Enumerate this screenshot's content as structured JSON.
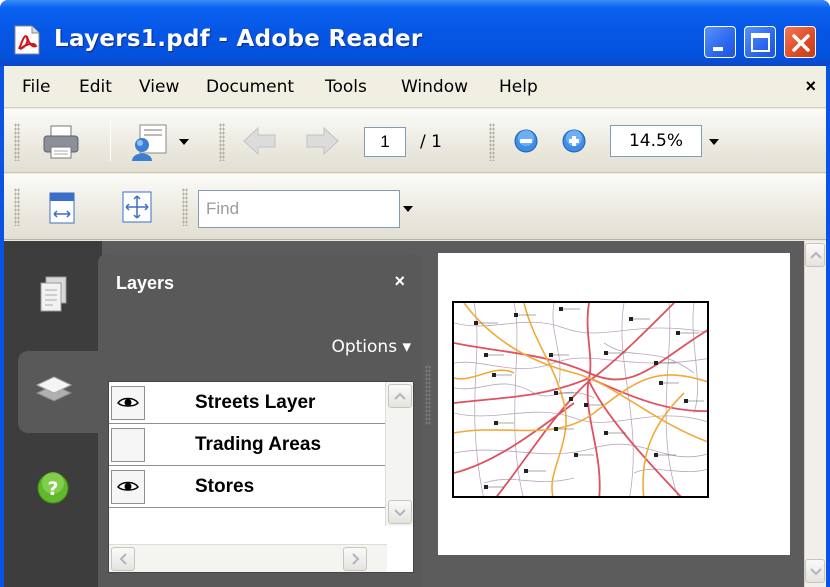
{
  "window": {
    "title": "Layers1.pdf - Adobe Reader"
  },
  "menu": {
    "items": [
      "File",
      "Edit",
      "View",
      "Document",
      "Tools",
      "Window",
      "Help"
    ],
    "close_glyph": "×"
  },
  "toolbar": {
    "page_current": "1",
    "page_total": "/ 1",
    "zoom": "14.5%",
    "find_placeholder": "Find"
  },
  "layers_panel": {
    "title": "Layers",
    "close_glyph": "×",
    "options_label": "Options ▾",
    "layers": [
      {
        "label": "Streets Layer",
        "visible": true
      },
      {
        "label": "Trading Areas",
        "visible": false
      },
      {
        "label": "Stores",
        "visible": true
      }
    ]
  },
  "nav_tabs": [
    {
      "icon": "pages-icon",
      "active": false
    },
    {
      "icon": "layers-icon",
      "active": true
    },
    {
      "icon": "help-icon",
      "active": false
    }
  ],
  "colors": {
    "title_bar": "#0a61f0",
    "close_button": "#dd4a26",
    "panel_bg": "#595959",
    "main_bg": "#5c5c5c"
  }
}
